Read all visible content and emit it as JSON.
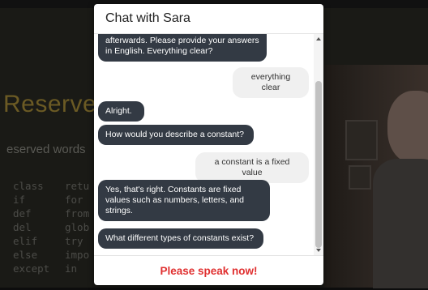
{
  "background": {
    "slide_title": "Reserved",
    "slide_subtitle": "eserved words",
    "keywords": [
      "class",
      "retu",
      "if",
      "for",
      "def",
      "from",
      "del",
      "glob",
      "elif",
      "try",
      "else",
      "impo",
      "except",
      "in"
    ]
  },
  "chat": {
    "title": "Chat with Sara",
    "messages": [
      {
        "from": "bot",
        "text": "afterwards. Please provide your answers in English. Everything clear?"
      },
      {
        "from": "user",
        "text": "everything clear"
      },
      {
        "from": "bot",
        "text": "Alright."
      },
      {
        "from": "bot",
        "text": "How would you describe a constant?"
      },
      {
        "from": "user",
        "text": "a constant is a fixed value"
      },
      {
        "from": "bot",
        "text": "Yes, that's right. Constants are fixed values such as numbers, letters, and strings."
      },
      {
        "from": "bot",
        "text": "What different types of constants exist?"
      }
    ],
    "status": "Please speak now!"
  },
  "colors": {
    "bot_bubble": "#333a44",
    "user_bubble": "#f0f0f0",
    "status_text": "#e03030"
  }
}
